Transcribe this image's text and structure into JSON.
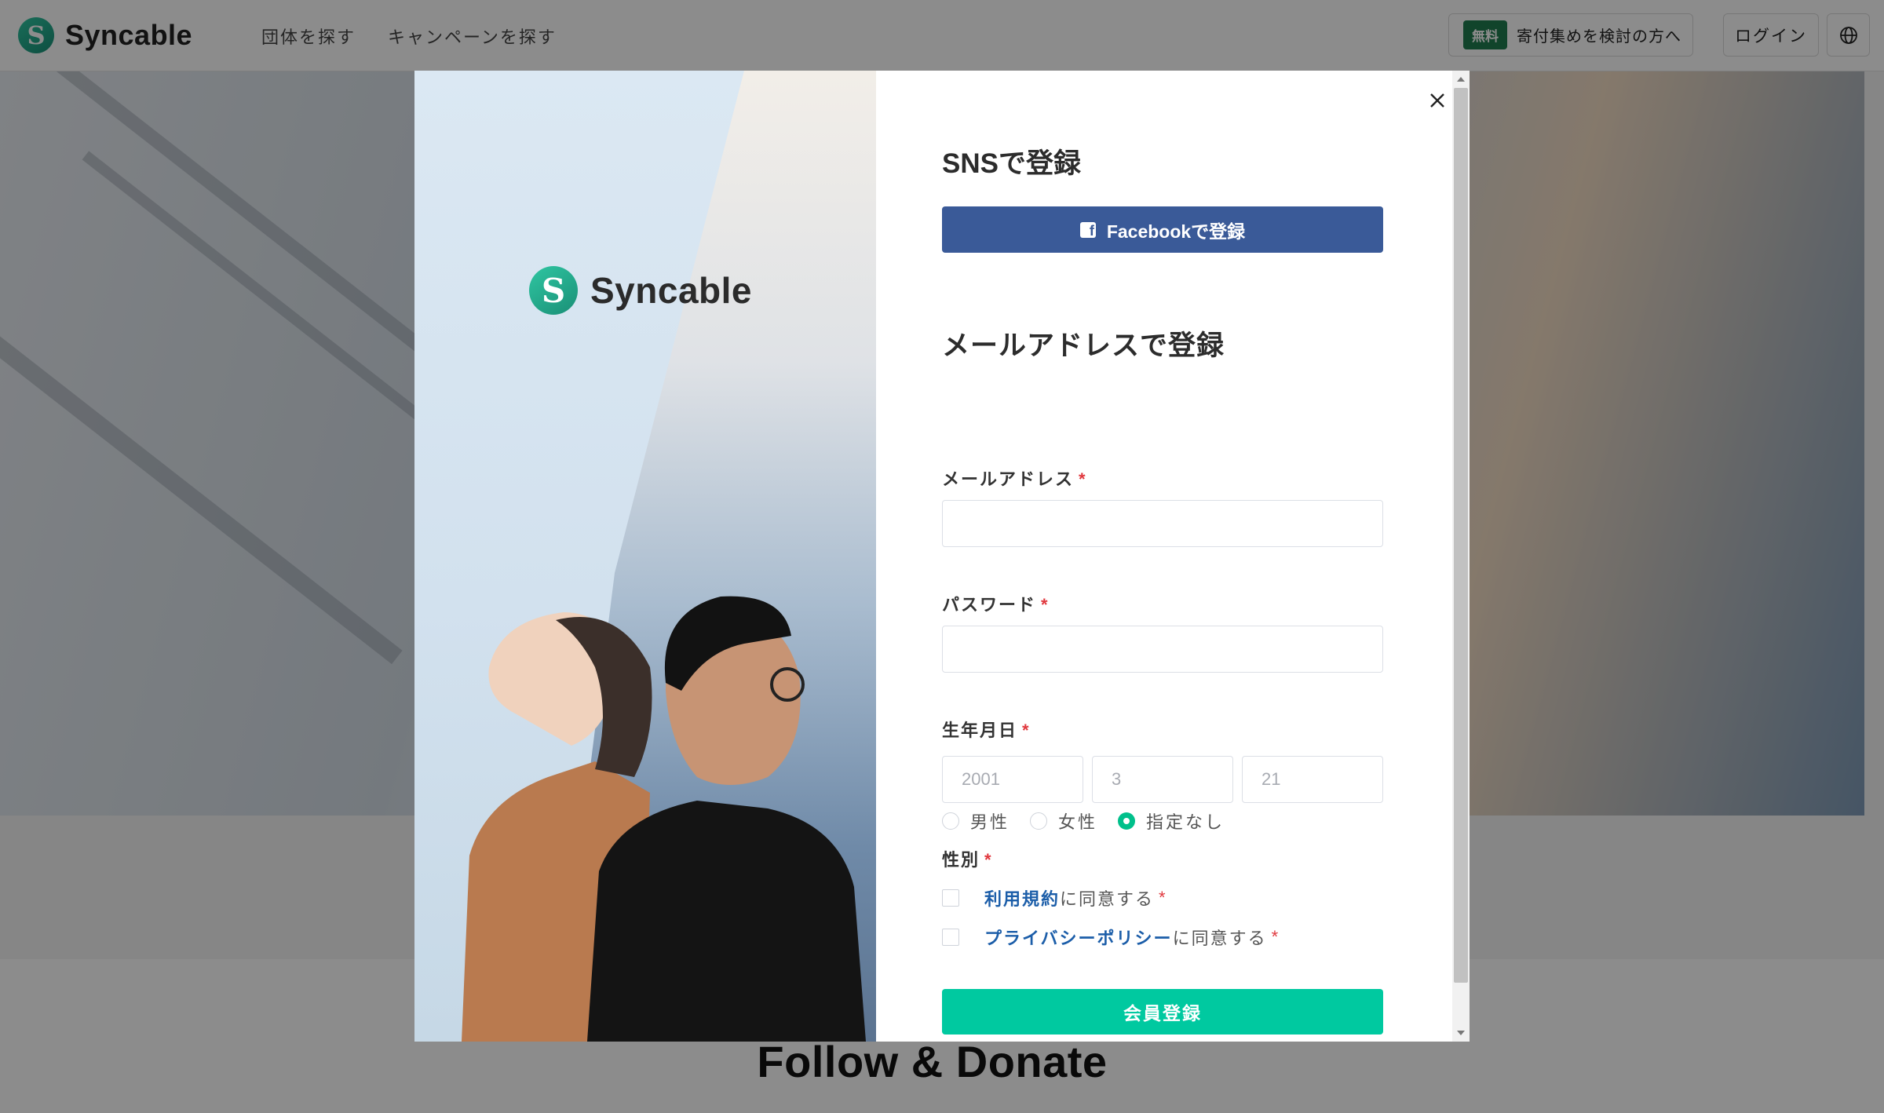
{
  "header": {
    "brand": "Syncable",
    "nav": [
      "団体を探す",
      "キャンペーンを探す"
    ],
    "cta_badge": "無料",
    "cta_text": "寄付集めを検討の方へ",
    "login": "ログイン",
    "globe_icon": "globe-icon"
  },
  "page": {
    "section_title": "Follow & Donate"
  },
  "modal": {
    "brand": "Syncable",
    "sns_heading": "SNSで登録",
    "facebook_button": "Facebookで登録",
    "facebook_icon": "facebook-icon",
    "email_heading": "メールアドレスで登録",
    "fields": {
      "email_label": "メールアドレス",
      "email_value": "",
      "password_label": "パスワード",
      "password_value": "",
      "birthdate_label": "生年月日",
      "birth_year_placeholder": "2001",
      "birth_month_placeholder": "3",
      "birth_day_placeholder": "21",
      "gender_label": "性別",
      "gender_options": [
        "男性",
        "女性",
        "指定なし"
      ],
      "gender_selected": "指定なし"
    },
    "required_mark": "*",
    "terms": {
      "terms_link": "利用規約",
      "terms_suffix": "に同意する",
      "privacy_link": "プライバシーポリシー",
      "privacy_suffix": "に同意する"
    },
    "submit": "会員登録",
    "close_icon": "close-icon"
  },
  "colors": {
    "brand_green": "#00c9a0",
    "facebook_blue": "#3a5a98",
    "link_blue": "#1c5ea9",
    "required_red": "#e0373d",
    "free_badge_green": "#1f7d4f"
  }
}
